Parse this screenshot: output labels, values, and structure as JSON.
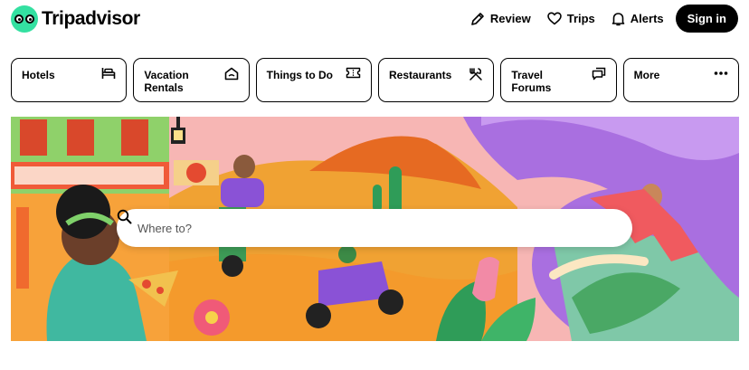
{
  "brand": {
    "name": "Tripadvisor",
    "accent": "#34e0a1"
  },
  "nav": {
    "review_label": "Review",
    "trips_label": "Trips",
    "alerts_label": "Alerts",
    "signin_label": "Sign in"
  },
  "categories": [
    {
      "label": "Hotels",
      "icon": "bed-icon"
    },
    {
      "label": "Vacation Rentals",
      "icon": "house-icon"
    },
    {
      "label": "Things to Do",
      "icon": "ticket-icon"
    },
    {
      "label": "Restaurants",
      "icon": "utensils-icon"
    },
    {
      "label": "Travel Forums",
      "icon": "chat-icon"
    },
    {
      "label": "More",
      "icon": "more-dots-icon"
    }
  ],
  "search": {
    "placeholder": "Where to?",
    "value": ""
  }
}
